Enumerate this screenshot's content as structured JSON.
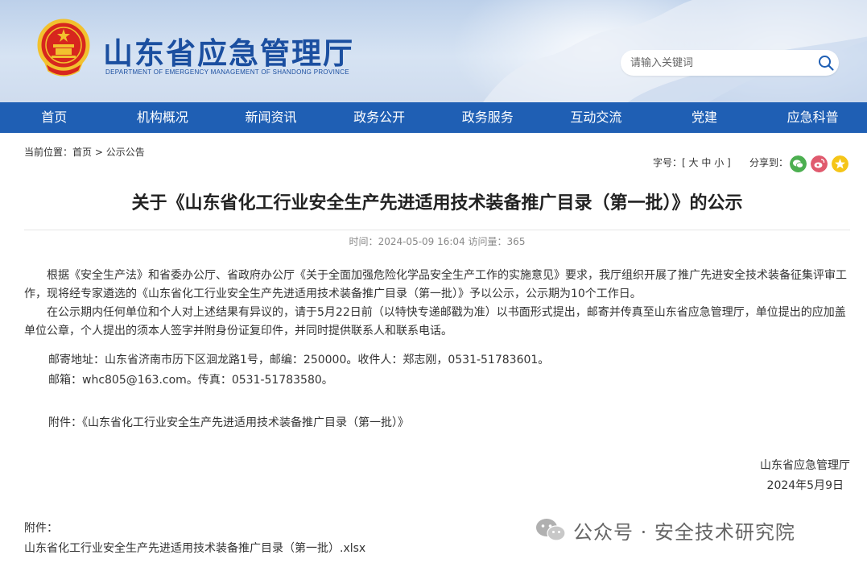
{
  "header": {
    "title": "山东省应急管理厅",
    "subtitle": "DEPARTMENT OF EMERGENCY MANAGEMENT OF SHANDONG PROVINCE",
    "search_placeholder": "请输入关键词"
  },
  "nav": {
    "items": [
      "首页",
      "机构概况",
      "新闻资讯",
      "政务公开",
      "政务服务",
      "互动交流",
      "党建",
      "应急科普"
    ]
  },
  "breadcrumb": {
    "prefix": "当前位置：",
    "home": "首页",
    "sep": " > ",
    "current": "公示公告"
  },
  "tools": {
    "fontsize_label": "字号：",
    "fontsize_open": "[ ",
    "large": "大",
    "medium": "中",
    "small": "小",
    "fontsize_close": " ]",
    "share_label": "分享到：",
    "share_icons": [
      "wechat-icon",
      "weibo-icon",
      "qzone-icon"
    ],
    "colors": {
      "wechat": "#4caf50",
      "weibo": "#e05a6e",
      "qzone": "#f5c518"
    }
  },
  "article": {
    "title": "关于《山东省化工行业安全生产先进适用技术装备推广目录（第一批）》的公示",
    "meta_time_label": "时间：",
    "meta_time": "2024-05-09 16:04",
    "meta_views_label": "访问量：",
    "meta_views": "365",
    "paragraph1": "根据《安全生产法》和省委办公厅、省政府办公厅《关于全面加强危险化学品安全生产工作的实施意见》要求，我厅组织开展了推广先进安全技术装备征集评审工作，现将经专家遴选的《山东省化工行业安全生产先进适用技术装备推广目录（第一批）》予以公示，公示期为10个工作日。",
    "paragraph2": "在公示期内任何单位和个人对上述结果有异议的，请于5月22日前（以特快专递邮戳为准）以书面形式提出，邮寄并传真至山东省应急管理厅，单位提出的应加盖单位公章，个人提出的须本人签字并附身份证复印件，并同时提供联系人和联系电话。",
    "address": "邮寄地址：山东省济南市历下区洄龙路1号，邮编：250000。收件人：郑志刚，0531-51783601。",
    "email": "邮箱：whc805@163.com。传真：0531-51783580。",
    "attachment_inline": "附件：《山东省化工行业安全生产先进适用技术装备推广目录（第一批）》",
    "signer": "山东省应急管理厅",
    "date": "2024年5月9日",
    "attach_label": "附件：",
    "attach_file": "山东省化工行业安全生产先进适用技术装备推广目录（第一批）.xlsx"
  },
  "watermark": {
    "text": "公众号 · 安全技术研究院"
  },
  "colors": {
    "nav_bg": "#1f5fb4",
    "title_blue": "#1b4fa0",
    "emblem_red": "#d7261e",
    "emblem_gold": "#f2c12e"
  }
}
